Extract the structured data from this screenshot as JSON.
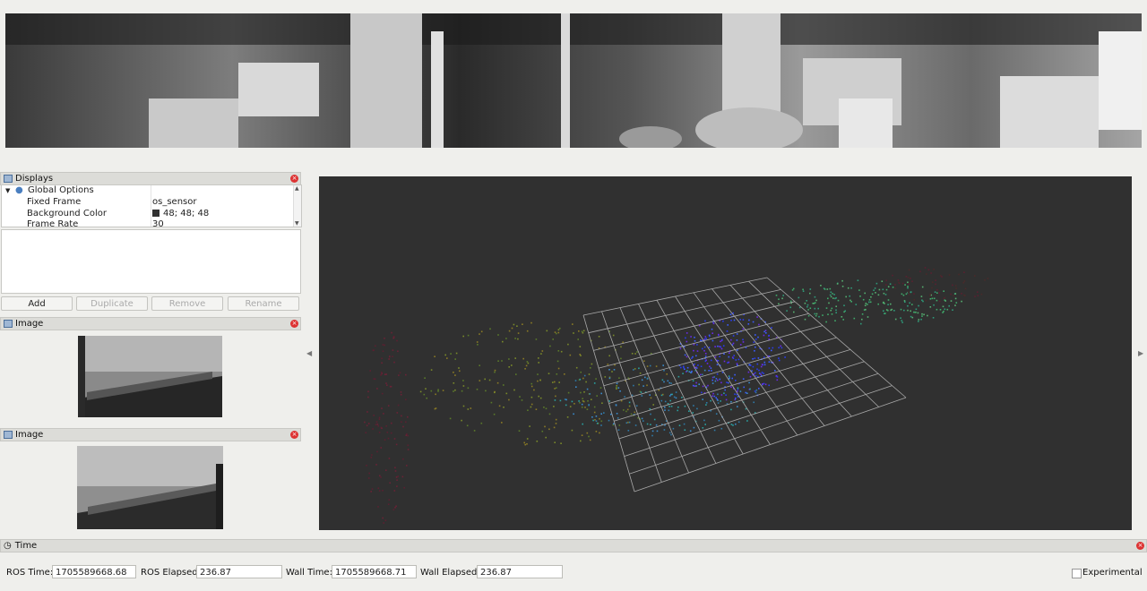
{
  "displays_panel": {
    "title": "Displays",
    "tree": {
      "root_label": "Global Options",
      "rows": [
        {
          "key": "Fixed Frame",
          "value": "os_sensor"
        },
        {
          "key": "Background Color",
          "value": "48; 48; 48"
        },
        {
          "key": "Frame Rate",
          "value": "30"
        }
      ]
    },
    "buttons": {
      "add": "Add",
      "duplicate": "Duplicate",
      "remove": "Remove",
      "rename": "Rename"
    }
  },
  "image_panel_1": {
    "title": "Image"
  },
  "image_panel_2": {
    "title": "Image"
  },
  "time_panel": {
    "title": "Time",
    "ros_time_label": "ROS Time:",
    "ros_time": "1705589668.68",
    "ros_elapsed_label": "ROS Elapsed:",
    "ros_elapsed": "236.87",
    "wall_time_label": "Wall Time:",
    "wall_time": "1705589668.71",
    "wall_elapsed_label": "Wall Elapsed:",
    "wall_elapsed": "236.87",
    "experimental_label": "Experimental"
  },
  "colors": {
    "background": "#303030",
    "grid": "#a0a0a0",
    "panel_header": "#dcdcd8",
    "close": "#dd3333"
  },
  "icons": [
    "monitor-icon",
    "globe-icon",
    "image-icon",
    "clock-icon",
    "close-icon",
    "expand-arrow-icon"
  ]
}
